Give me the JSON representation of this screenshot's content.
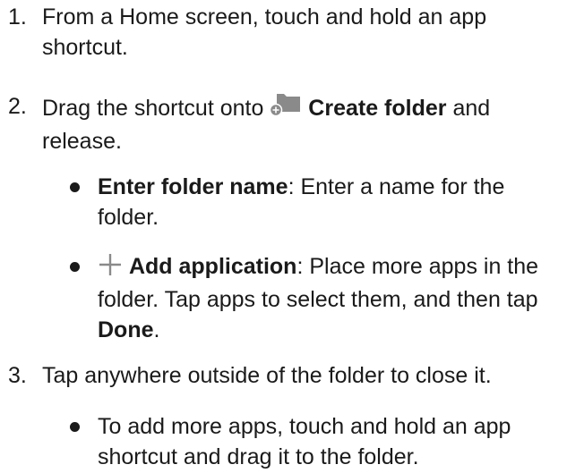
{
  "steps": [
    {
      "number": "1.",
      "line1": "From a Home screen, touch and hold an app",
      "line2": "shortcut."
    },
    {
      "number": "2.",
      "pre": "Drag the shortcut onto",
      "bold": "Create folder",
      "post": "and",
      "line2": "release.",
      "icon": "folder-add-icon"
    },
    {
      "number": "3.",
      "text": "Tap anywhere outside of the folder to close it."
    }
  ],
  "bullets_step2": [
    {
      "bold": "Enter folder name",
      "rest": ": Enter a name for the",
      "line2": "folder."
    },
    {
      "icon": "plus-icon",
      "bold": "Add application",
      "rest": ": Place more apps in the",
      "line2": "folder. Tap apps to select them, and then tap",
      "line3_bold": "Done",
      "line3_rest": "."
    }
  ],
  "bullets_step3": [
    {
      "line1": "To add more apps, touch and hold an app",
      "line2": "shortcut and drag it to the folder."
    }
  ],
  "colors": {
    "text": "#1a1a1a",
    "icon_gray": "#8a8a8a"
  }
}
